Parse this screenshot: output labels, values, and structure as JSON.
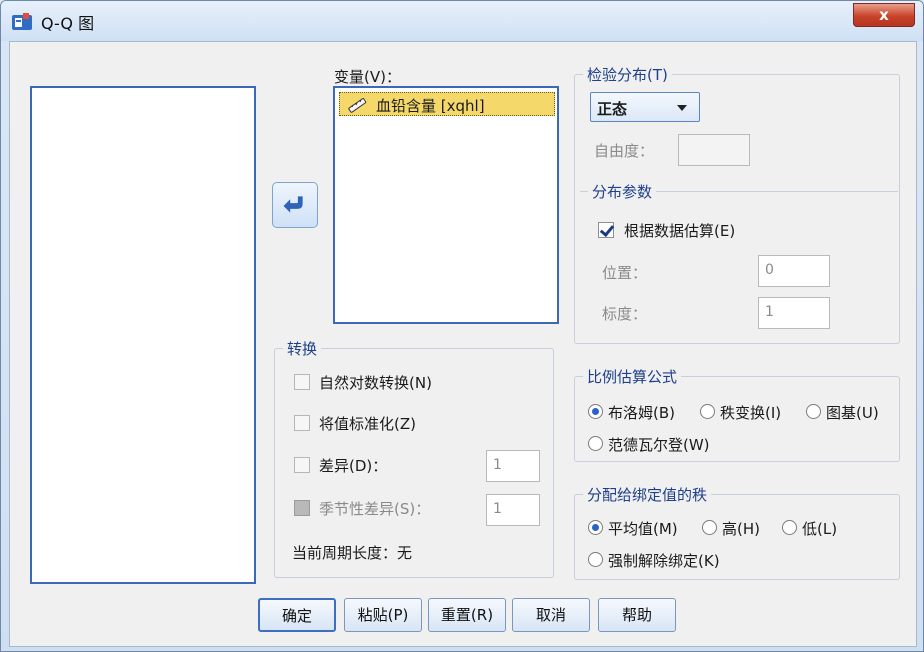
{
  "window": {
    "title": "Q-Q 图",
    "close_label": "x"
  },
  "source_list": {
    "items": []
  },
  "variables": {
    "label": "变量(V)：",
    "items": [
      {
        "label": "血铅含量 [xqhl]"
      }
    ]
  },
  "test_distribution": {
    "title": "检验分布(T)",
    "selected": "正态",
    "df_label": "自由度："
  },
  "dist_params": {
    "title": "分布参数",
    "estimate_label": "根据数据估算(E)",
    "estimate_checked": true,
    "location_label": "位置：",
    "location_value": "0",
    "scale_label": "标度：",
    "scale_value": "1"
  },
  "transform": {
    "title": "转换",
    "natural_log": "自然对数转换(N)",
    "standardize": "将值标准化(Z)",
    "difference": "差异(D)：",
    "difference_value": "1",
    "seasonal_difference": "季节性差异(S)：",
    "seasonal_value": "1",
    "period_text": "当前周期长度：无"
  },
  "proportion": {
    "title": "比例估算公式",
    "options": [
      "布洛姆(B)",
      "秩变换(I)",
      "图基(U)",
      "范德瓦尔登(W)"
    ],
    "selected_index": 0
  },
  "ties": {
    "title": "分配给绑定值的秩",
    "options": [
      "平均值(M)",
      "高(H)",
      "低(L)",
      "强制解除绑定(K)"
    ],
    "selected_index": 0
  },
  "buttons": {
    "ok": "确定",
    "paste": "粘贴(P)",
    "reset": "重置(R)",
    "cancel": "取消",
    "help": "帮助"
  },
  "colors": {
    "accent": "#3c68b6",
    "selection": "#f5d86a",
    "close": "#c9432c"
  }
}
